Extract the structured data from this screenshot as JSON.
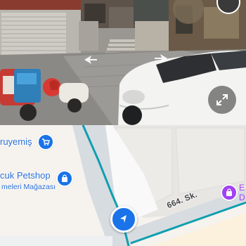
{
  "street_view": {
    "expand_icon": "expand-arrows-icon",
    "nav_arrow_icon": "street-view-nav-arrow-icon",
    "top_button_icon": "compass-icon"
  },
  "map": {
    "pois": [
      {
        "label": "ruyemiş",
        "icon": "shopping-cart-icon",
        "color": "#1a73e8"
      },
      {
        "label": "cuk Petshop",
        "sublabel": "meleri Mağazası",
        "icon": "shopping-bag-icon",
        "color": "#1a73e8"
      },
      {
        "label": "E",
        "sublabel": "D",
        "icon": "shopping-bag-icon",
        "color": "#a142f4"
      }
    ],
    "street_name": "664. Sk.",
    "location_marker_icon": "navigation-arrow-icon",
    "route_color": "#0f9fb0"
  }
}
